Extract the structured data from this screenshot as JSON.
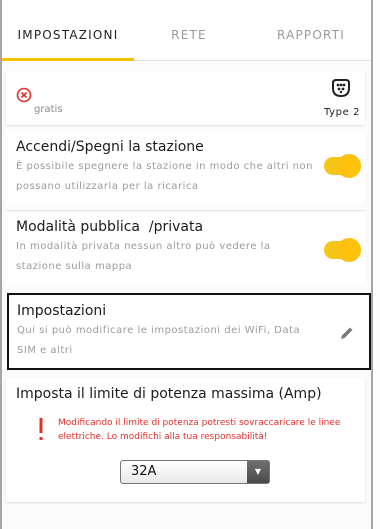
{
  "tabs": [
    {
      "label": "IMPOSTAZIONI"
    },
    {
      "label": "RETE"
    },
    {
      "label": "RAPPORTI"
    }
  ],
  "tariff": {
    "label": "gratis",
    "connector": "Type 2"
  },
  "power_toggle": {
    "title": "Accendi/Spegni la stazione",
    "description": "È possibile spegnere la stazione in modo che altri non possano utilizzarla per la ricarica",
    "enabled": true
  },
  "public_mode": {
    "title": "Modalità pubblica  /privata",
    "description": "In modalità privata nessun altro può vedere la stazione sulla mappa",
    "enabled": true
  },
  "settings_card": {
    "title": "Impostazioni",
    "description": "Qui si può modificare le impostazioni dei WiFi, Data SIM e altri"
  },
  "power_limit": {
    "title": "Imposta il limite di potenza massima (Amp)",
    "warning": "Modificando il limite di potenza potresti sovraccaricare le linee elettriche. Lo modifichi alla tua responsabilità!",
    "selected": "32A"
  },
  "colors": {
    "accent": "#f5c518",
    "warning": "#e0302a"
  },
  "icons": {
    "tariff_status": "error-circle-icon",
    "connector": "type2-connector-icon",
    "edit": "pencil-icon",
    "warning": "exclamation-icon",
    "select_arrow": "caret-down-icon"
  }
}
